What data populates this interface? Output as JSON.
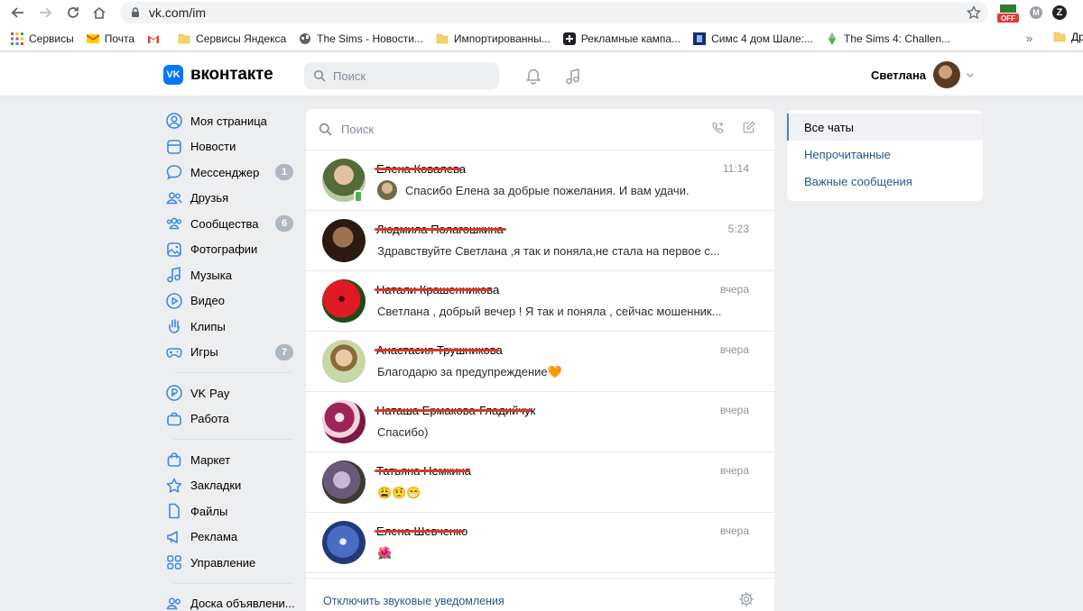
{
  "browser": {
    "url": "vk.com/im",
    "ext_off_label": "OFF",
    "ext_m_label": "M",
    "ext_z_label": "Z",
    "bookmarks": [
      {
        "label": "Сервисы",
        "icon": "apps-grid-icon"
      },
      {
        "label": "Почта",
        "icon": "yandex-mail-icon"
      },
      {
        "label": "",
        "icon": "gmail-icon"
      },
      {
        "label": "Сервисы Яндекса",
        "icon": "folder-icon"
      },
      {
        "label": "The Sims - Новости...",
        "icon": "globe-icon"
      },
      {
        "label": "Импортированны...",
        "icon": "folder-icon"
      },
      {
        "label": "Рекламные кампа...",
        "icon": "ads-icon"
      },
      {
        "label": "Симс 4 дом Шале:...",
        "icon": "site-icon"
      },
      {
        "label": "The Sims 4: Challen...",
        "icon": "plumbob-icon"
      }
    ],
    "more": "»",
    "last_bookmark": "Др"
  },
  "header": {
    "logo_text": "вконтакте",
    "logo_mark": "VK",
    "search_placeholder": "Поиск",
    "user_name": "Светлана"
  },
  "sidebar": {
    "items": [
      {
        "label": "Моя страница",
        "icon": "user-circle-icon",
        "badge": ""
      },
      {
        "label": "Новости",
        "icon": "news-icon",
        "badge": ""
      },
      {
        "label": "Мессенджер",
        "icon": "message-icon",
        "badge": "1"
      },
      {
        "label": "Друзья",
        "icon": "friends-icon",
        "badge": ""
      },
      {
        "label": "Сообщества",
        "icon": "communities-icon",
        "badge": "6"
      },
      {
        "label": "Фотографии",
        "icon": "photo-icon",
        "badge": ""
      },
      {
        "label": "Музыка",
        "icon": "music-icon",
        "badge": ""
      },
      {
        "label": "Видео",
        "icon": "video-icon",
        "badge": ""
      },
      {
        "label": "Клипы",
        "icon": "clips-icon",
        "badge": ""
      },
      {
        "label": "Игры",
        "icon": "games-icon",
        "badge": "7"
      }
    ],
    "items2": [
      {
        "label": "VK Pay",
        "icon": "vkpay-icon"
      },
      {
        "label": "Работа",
        "icon": "briefcase-icon"
      }
    ],
    "items3": [
      {
        "label": "Маркет",
        "icon": "shop-bag-icon"
      },
      {
        "label": "Закладки",
        "icon": "star-icon"
      },
      {
        "label": "Файлы",
        "icon": "file-icon"
      },
      {
        "label": "Реклама",
        "icon": "megaphone-icon"
      },
      {
        "label": "Управление",
        "icon": "grid-manage-icon"
      }
    ],
    "items4": [
      {
        "label": "Доска объявлени...",
        "icon": "board-icon"
      }
    ]
  },
  "messenger": {
    "search_placeholder": "Поиск",
    "dialogs": [
      {
        "name": "Елена Ковалева",
        "time": "11:14",
        "message": "Спасибо Елена за добрые пожелания. И вам удачи.",
        "has_thumb": true,
        "online": true,
        "avatar_color": "#8a9a6a"
      },
      {
        "name": "Людмила Полагошкина",
        "time": "5:23",
        "message": "Здравствуйте Светлана ,я так и поняла,не стала на первое с...",
        "has_thumb": false,
        "online": false,
        "avatar_color": "#5a4030"
      },
      {
        "name": "Натали Крашенникова",
        "time": "вчера",
        "message": "Светлана , добрый вечер ! Я так и поняла , сейчас мошенник...",
        "has_thumb": false,
        "online": false,
        "avatar_color": "#c8141e"
      },
      {
        "name": "Анастасия Трушникова",
        "time": "вчера",
        "message": "Благодарю за предупреждение🧡",
        "has_thumb": false,
        "online": false,
        "avatar_color": "#a8b890"
      },
      {
        "name": "Наташа Ермакова-Гладийчук",
        "time": "вчера",
        "message": "Спасибо)",
        "has_thumb": false,
        "online": false,
        "avatar_color": "#9a2a5a"
      },
      {
        "name": "Татьяна Немкина",
        "time": "вчера",
        "message": "😩🤨😁",
        "has_thumb": false,
        "online": false,
        "avatar_color": "#6a5a7a"
      },
      {
        "name": "Елена Шевченко",
        "time": "вчера",
        "message": "🌺",
        "has_thumb": false,
        "online": false,
        "avatar_color": "#3a5aa8"
      }
    ],
    "footer_link": "Отключить звуковые уведомления"
  },
  "filters": {
    "items": [
      {
        "label": "Все чаты"
      },
      {
        "label": "Непрочитанные"
      },
      {
        "label": "Важные сообщения"
      }
    ]
  },
  "colors": {
    "vk_blue": "#0077ff",
    "link": "#2a5885",
    "sidebar_icon": "#3f8ae0",
    "strike": "#d93a2b"
  }
}
